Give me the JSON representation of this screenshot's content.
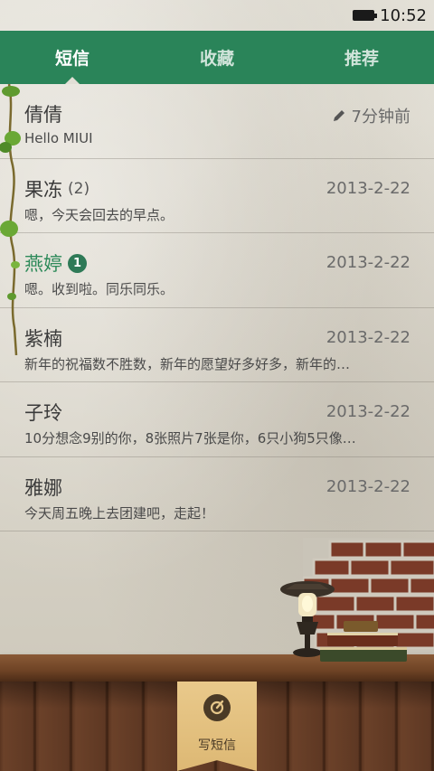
{
  "status": {
    "time": "10:52",
    "battery_icon": "battery-icon"
  },
  "tabs": [
    {
      "label": "短信",
      "active": true
    },
    {
      "label": "收藏",
      "active": false
    },
    {
      "label": "推荐",
      "active": false
    }
  ],
  "threads": [
    {
      "name": "倩倩",
      "count": "",
      "badge": "",
      "date": "7分钟前",
      "draft": true,
      "preview": "Hello MIUI",
      "unread": false
    },
    {
      "name": "果冻",
      "count": "(2)",
      "badge": "",
      "date": "2013-2-22",
      "draft": false,
      "preview": "嗯，今天会回去的早点。",
      "unread": false
    },
    {
      "name": "燕婷",
      "count": "",
      "badge": "1",
      "date": "2013-2-22",
      "draft": false,
      "preview": "嗯。收到啦。同乐同乐。",
      "unread": true
    },
    {
      "name": "紫楠",
      "count": "",
      "badge": "",
      "date": "2013-2-22",
      "draft": false,
      "preview": "新年的祝福数不胜数，新年的愿望好多好多，新年的…",
      "unread": false
    },
    {
      "name": "子玲",
      "count": "",
      "badge": "",
      "date": "2013-2-22",
      "draft": false,
      "preview": "10分想念9别的你，8张照片7张是你，6只小狗5只像…",
      "unread": false
    },
    {
      "name": "雅娜",
      "count": "",
      "badge": "",
      "date": "2013-2-22",
      "draft": false,
      "preview": "今天周五晚上去团建吧，走起！",
      "unread": false
    }
  ],
  "compose": {
    "label": "写短信",
    "icon": "compose-icon"
  },
  "colors": {
    "tab_bar": "#2a8459",
    "unread_name": "#2e8a5a",
    "badge": "#2e7a57"
  }
}
